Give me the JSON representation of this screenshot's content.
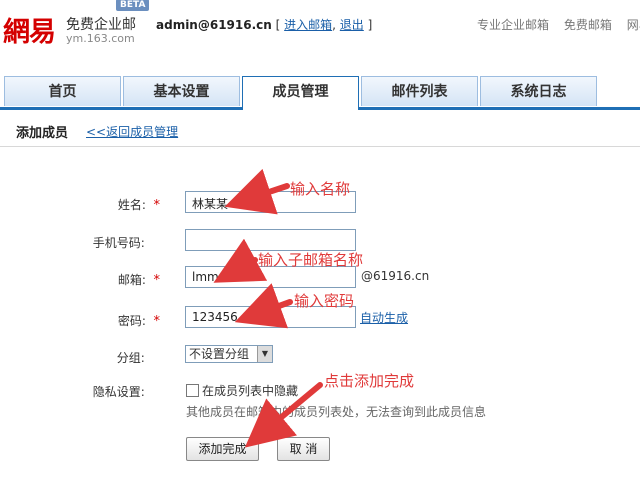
{
  "header": {
    "logo_text": "網易",
    "product": "免费企业邮",
    "beta": "BETA",
    "domain": "ym.163.com",
    "user_email": "admin@61916.cn",
    "enter_mailbox": "进入邮箱",
    "logout": "退出",
    "top_links": [
      "专业企业邮箱",
      "免费邮箱",
      "网易"
    ]
  },
  "tabs": [
    "首页",
    "基本设置",
    "成员管理",
    "邮件列表",
    "系统日志"
  ],
  "active_tab": "成员管理",
  "section": {
    "title": "添加成员",
    "back_link": "<<返回成员管理"
  },
  "form": {
    "name_label": "姓名:",
    "name_value": "林某某",
    "phone_label": "手机号码:",
    "phone_value": "",
    "mailbox_label": "邮箱:",
    "mailbox_value": "lmm",
    "mailbox_suffix": "@61916.cn",
    "password_label": "密码:",
    "password_value": "123456",
    "auto_generate": "自动生成",
    "group_label": "分组:",
    "group_value": "不设置分组",
    "privacy_label": "隐私设置:",
    "privacy_checkbox": "在成员列表中隐藏",
    "privacy_checked": false,
    "privacy_note": "其他成员在邮箱内的成员列表处，无法查询到此成员信息",
    "required_mark": "*",
    "submit": "添加完成",
    "cancel": "取 消"
  },
  "annotations": {
    "name_hint": "输入名称",
    "mailbox_hint": "输入子邮箱名称",
    "password_hint": "输入密码",
    "submit_hint": "点击添加完成",
    "color": "#e03a3a"
  },
  "colors": {
    "brand_red": "#d40000",
    "tab_border": "#1f6fb5",
    "link": "#1a5fa8"
  }
}
